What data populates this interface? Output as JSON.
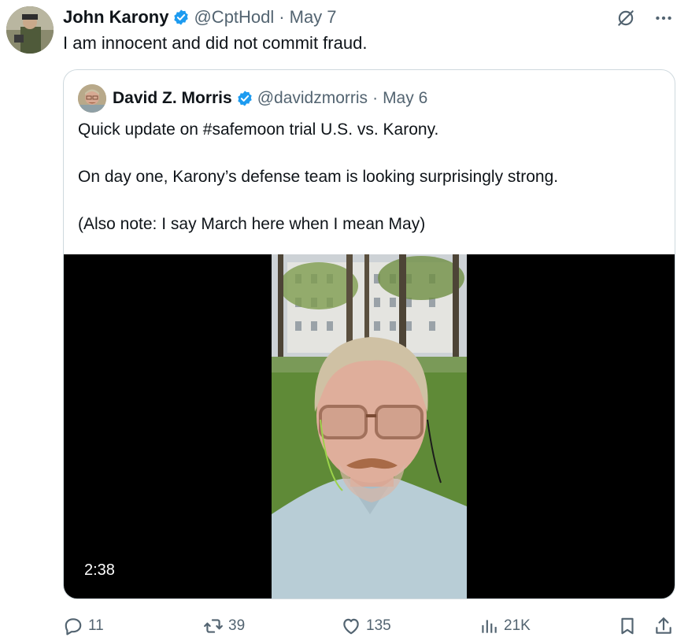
{
  "tweet": {
    "author_name": "John Karony",
    "handle": "@CptHodl",
    "separator": "·",
    "date": "May 7",
    "text": "I am innocent and did not commit fraud.",
    "icons": {
      "grok": "grok-icon",
      "more": "more-icon",
      "verified": "verified-badge-icon"
    }
  },
  "quoted_tweet": {
    "author_name": "David Z. Morris",
    "handle": "@davidzmorris",
    "separator": "·",
    "date": "May 6",
    "paragraphs": [
      "Quick update on #safemoon trial U.S. vs. Karony.",
      "On day one, Karony’s defense team is looking surprisingly strong.",
      "(Also note: I say March here when I mean May)"
    ],
    "video": {
      "duration": "2:38"
    }
  },
  "actions": {
    "replies": "11",
    "reposts": "39",
    "likes": "135",
    "views": "21K",
    "icons": [
      "reply-icon",
      "repost-icon",
      "like-icon",
      "views-icon",
      "bookmark-icon",
      "share-icon"
    ]
  },
  "colors": {
    "text": "#0f1419",
    "muted": "#536471",
    "verified": "#1d9bf0",
    "border": "#cfd9de",
    "video_bg": "#000000"
  }
}
